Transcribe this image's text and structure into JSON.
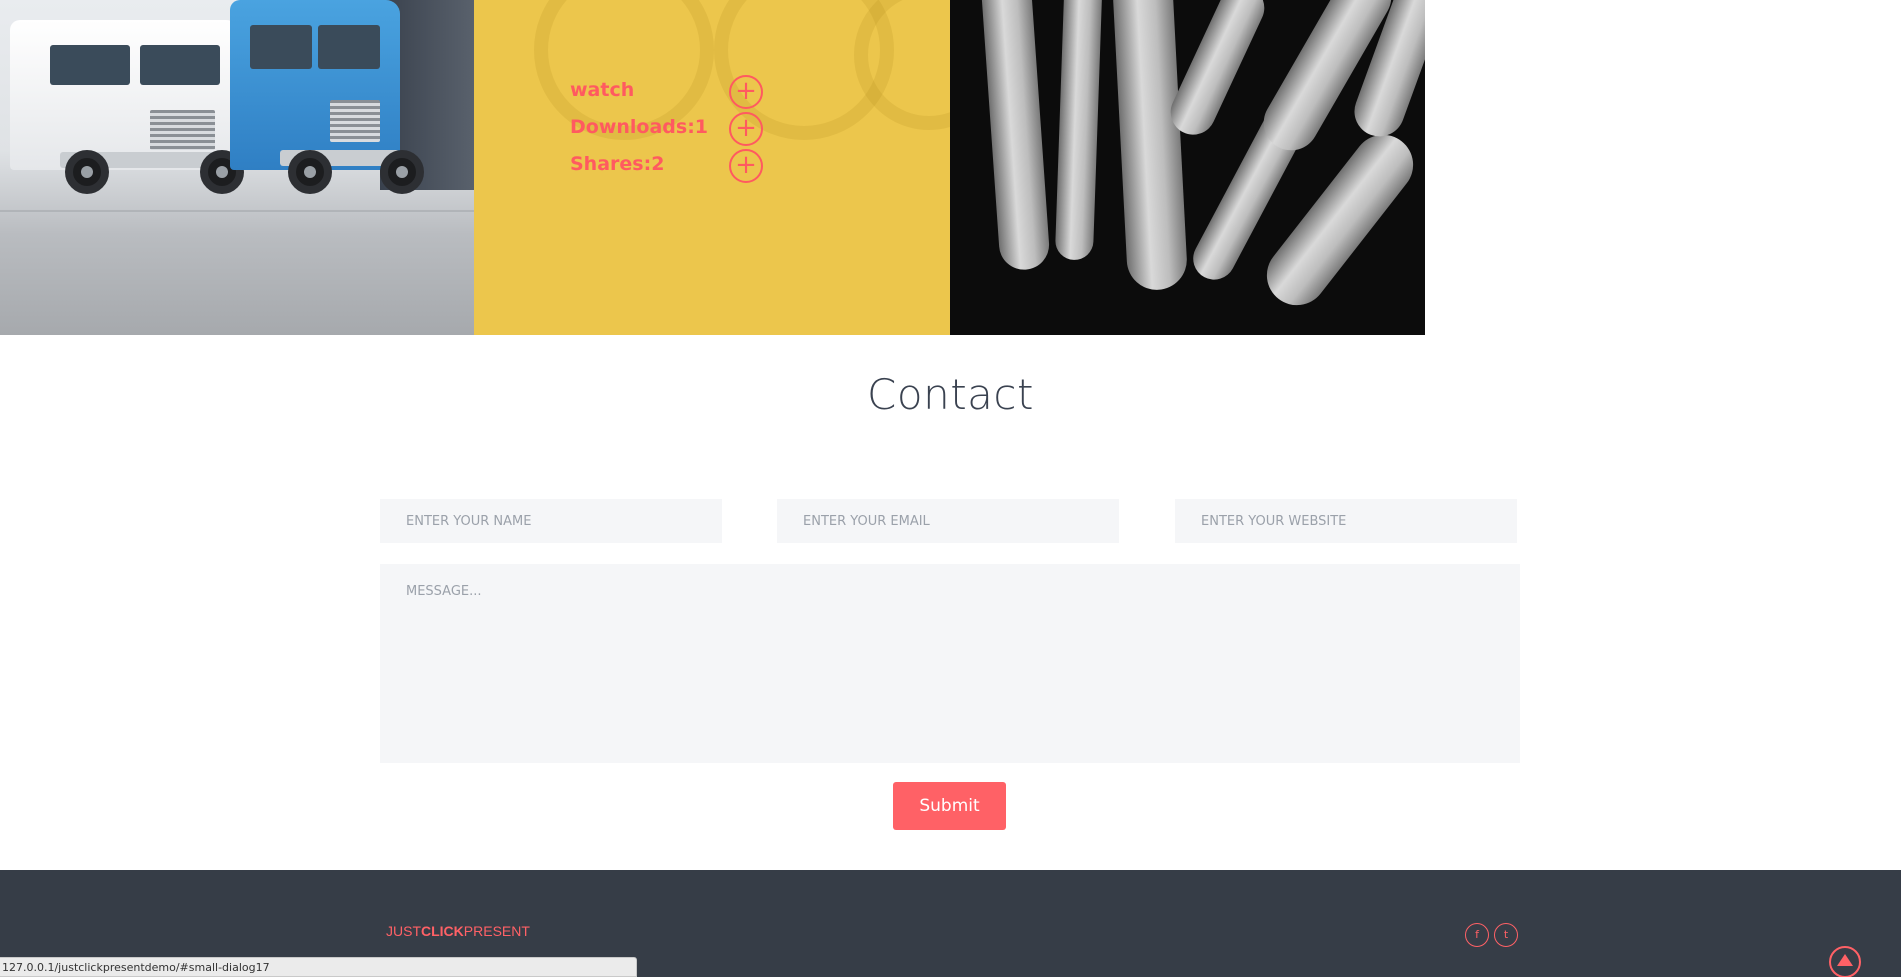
{
  "gallery": {
    "tiles": [
      {
        "name": "trucks-image"
      },
      {
        "name": "watch-image"
      },
      {
        "name": "zebra-image"
      }
    ],
    "overlay": {
      "items": [
        {
          "label": "watch",
          "icon": "plus-circle-icon"
        },
        {
          "label": "Downloads:1",
          "icon": "plus-circle-icon"
        },
        {
          "label": "Shares:2",
          "icon": "plus-circle-icon"
        }
      ],
      "accent_color": "#ff5a60",
      "tile_color": "#ecc64c"
    }
  },
  "contact": {
    "title": "Contact",
    "name_placeholder": "ENTER YOUR NAME",
    "email_placeholder": "ENTER YOUR EMAIL",
    "website_placeholder": "ENTER YOUR WEBSITE",
    "message_placeholder": "MESSAGE...",
    "submit_label": "Submit",
    "button_color": "#ff6166"
  },
  "footer": {
    "logo": {
      "part1": "JUST",
      "part2": "CLICK",
      "part3": "PRESENT"
    },
    "social": [
      {
        "icon": "facebook-icon",
        "glyph": "f"
      },
      {
        "icon": "twitter-icon",
        "glyph": "t"
      }
    ],
    "back_to_top_icon": "arrow-up-circle-icon",
    "background_color": "#363d47"
  },
  "status_bar": {
    "url": "127.0.0.1/justclickpresentdemo/#small-dialog17"
  }
}
